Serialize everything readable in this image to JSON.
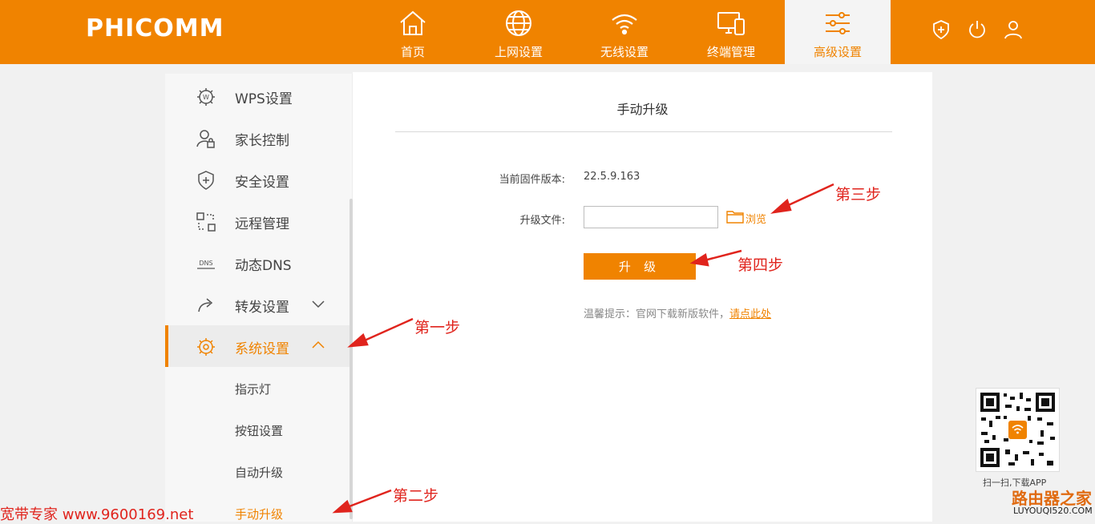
{
  "brand": {
    "logo_text": "PHICOMM",
    "color": "#f08300"
  },
  "nav": [
    {
      "label": "首页",
      "icon": "home-icon",
      "active": false
    },
    {
      "label": "上网设置",
      "icon": "globe-icon",
      "active": false
    },
    {
      "label": "无线设置",
      "icon": "wifi-icon",
      "active": false
    },
    {
      "label": "终端管理",
      "icon": "devices-icon",
      "active": false
    },
    {
      "label": "高级设置",
      "icon": "sliders-icon",
      "active": true
    }
  ],
  "top_actions": [
    {
      "icon": "shield-plus-icon"
    },
    {
      "icon": "power-icon"
    },
    {
      "icon": "user-icon"
    }
  ],
  "sidebar": {
    "items": [
      {
        "label": "WPS设置",
        "icon": "wps-gear-icon"
      },
      {
        "label": "家长控制",
        "icon": "parent-lock-icon"
      },
      {
        "label": "安全设置",
        "icon": "shield-plus-icon"
      },
      {
        "label": "远程管理",
        "icon": "remote-icon"
      },
      {
        "label": "动态DNS",
        "icon": "dns-icon"
      },
      {
        "label": "转发设置",
        "icon": "forward-icon",
        "expandable": true
      },
      {
        "label": "系统设置",
        "icon": "settings-gear-icon",
        "expandable": true,
        "expanded": true,
        "active": true
      }
    ],
    "sub_items": [
      {
        "label": "指示灯"
      },
      {
        "label": "按钮设置"
      },
      {
        "label": "自动升级"
      },
      {
        "label": "手动升级",
        "current": true
      }
    ]
  },
  "main": {
    "title": "手动升级",
    "firmware_label": "当前固件版本:",
    "firmware_value": "22.5.9.163",
    "file_label": "升级文件:",
    "file_value": "",
    "browse_label": "浏览",
    "upgrade_button": "升 级",
    "tip_text": "温馨提示：官网下载新版软件，",
    "tip_link": "请点此处"
  },
  "annotations": {
    "step1": "第一步",
    "step2": "第二步",
    "step3": "第三步",
    "step4": "第四步"
  },
  "qr": {
    "caption": "扫一扫,下载APP"
  },
  "watermarks": {
    "left": "宽带专家 www.9600169.net",
    "right_title": "路由器之家",
    "right_sub": "LUYOUQI520.COM"
  }
}
